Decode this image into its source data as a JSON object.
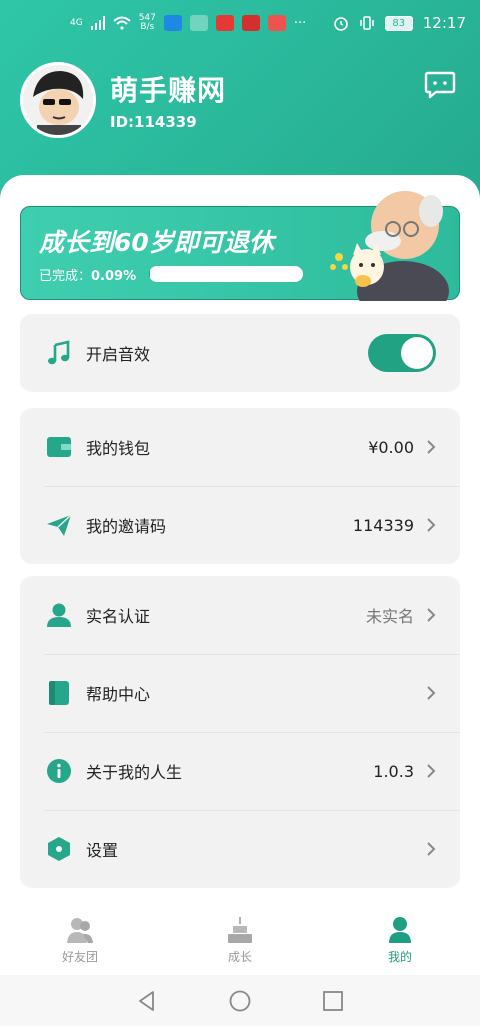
{
  "status_bar": {
    "network": "4G",
    "speed_value": "547",
    "speed_unit": "B/s",
    "battery": "83",
    "time": "12:17"
  },
  "profile": {
    "name": "萌手赚网",
    "id_text": "ID:114339"
  },
  "banner": {
    "title": "成长到60岁即可退休",
    "progress_label": "已完成：",
    "progress_value": "0.09%",
    "progress_fraction": 0.0009
  },
  "sound": {
    "label": "开启音效",
    "enabled": true
  },
  "wallet": {
    "label": "我的钱包",
    "value": "¥0.00"
  },
  "invite": {
    "label": "我的邀请码",
    "value": "114339"
  },
  "realname": {
    "label": "实名认证",
    "value": "未实名"
  },
  "help": {
    "label": "帮助中心"
  },
  "about": {
    "label": "关于我的人生",
    "value": "1.0.3"
  },
  "settings": {
    "label": "设置"
  },
  "tabs": [
    {
      "label": "好友团",
      "icon": "friends-icon",
      "active": false
    },
    {
      "label": "成长",
      "icon": "cake-icon",
      "active": false
    },
    {
      "label": "我的",
      "icon": "user-icon",
      "active": true
    }
  ],
  "colors": {
    "primary": "#2ab79a",
    "primary_dark": "#21a283",
    "card_bg": "#f2f2f2"
  }
}
